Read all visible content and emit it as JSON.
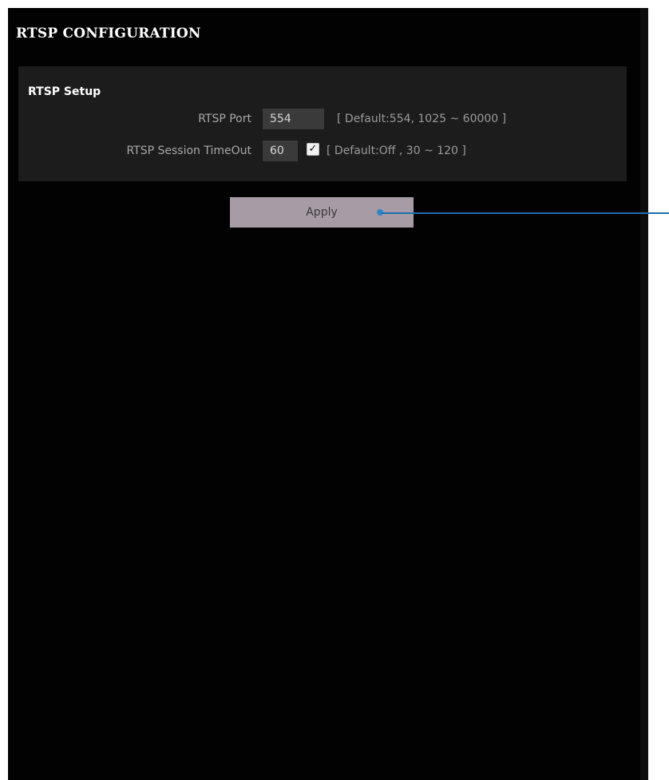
{
  "page": {
    "title": "RTSP CONFIGURATION"
  },
  "setup": {
    "section_title": "RTSP Setup",
    "rtsp_port": {
      "label": "RTSP Port",
      "value": "554",
      "hint": "[ Default:554, 1025 ~ 60000 ]"
    },
    "session_timeout": {
      "label": "RTSP Session TimeOut",
      "value": "60",
      "checked": true,
      "hint": "[ Default:Off , 30 ~ 120 ]"
    }
  },
  "actions": {
    "apply_label": "Apply"
  },
  "colors": {
    "background": "#020202",
    "section_background": "#1c1c1c",
    "button_background": "#a79ca6",
    "callout": "#2f86c8"
  }
}
